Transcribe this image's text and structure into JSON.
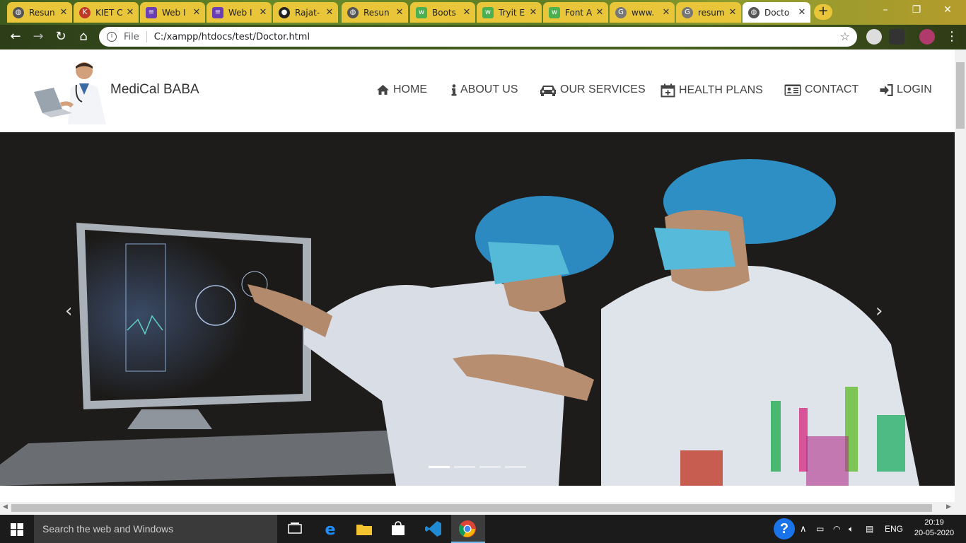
{
  "browser": {
    "tabs": [
      {
        "title": "Resun",
        "favicon": "globe-icon",
        "color": "#444"
      },
      {
        "title": "KIET C",
        "favicon": "kiet-icon",
        "color": "#c0392b"
      },
      {
        "title": "Web I",
        "favicon": "list-icon",
        "color": "#6a3fb5"
      },
      {
        "title": "Web I",
        "favicon": "list-icon",
        "color": "#6a3fb5"
      },
      {
        "title": "Rajat-",
        "favicon": "github-icon",
        "color": "#222"
      },
      {
        "title": "Resun",
        "favicon": "globe-icon",
        "color": "#444"
      },
      {
        "title": "Boots",
        "favicon": "w3-icon",
        "color": "#4caf50"
      },
      {
        "title": "Tryit E",
        "favicon": "w3-icon",
        "color": "#4caf50"
      },
      {
        "title": "Font A",
        "favicon": "w3-icon",
        "color": "#4caf50"
      },
      {
        "title": "www.",
        "favicon": "google-icon",
        "color": "#555"
      },
      {
        "title": "resum",
        "favicon": "google-icon",
        "color": "#555"
      },
      {
        "title": "Docto",
        "favicon": "globe-icon",
        "color": "#444"
      }
    ],
    "address": {
      "scheme_label": "File",
      "url": "C:/xampp/htdocs/test/Doctor.html"
    }
  },
  "site": {
    "brand": "MediCal BABA",
    "nav": [
      {
        "label": "HOME",
        "icon": "home-icon"
      },
      {
        "label": "ABOUT US",
        "icon": "info-icon"
      },
      {
        "label": "OUR SERVICES",
        "icon": "car-icon"
      },
      {
        "label": "HEALTH PLANS",
        "icon": "calendar-plus-icon"
      },
      {
        "label": "CONTACT",
        "icon": "id-card-icon"
      },
      {
        "label": "LOGIN",
        "icon": "sign-in-icon"
      }
    ],
    "carousel": {
      "prev": "‹",
      "next": "›",
      "slides": 4,
      "active": 0
    }
  },
  "taskbar": {
    "search_placeholder": "Search the web and Windows",
    "lang": "ENG",
    "time": "20:19",
    "date": "20-05-2020"
  }
}
